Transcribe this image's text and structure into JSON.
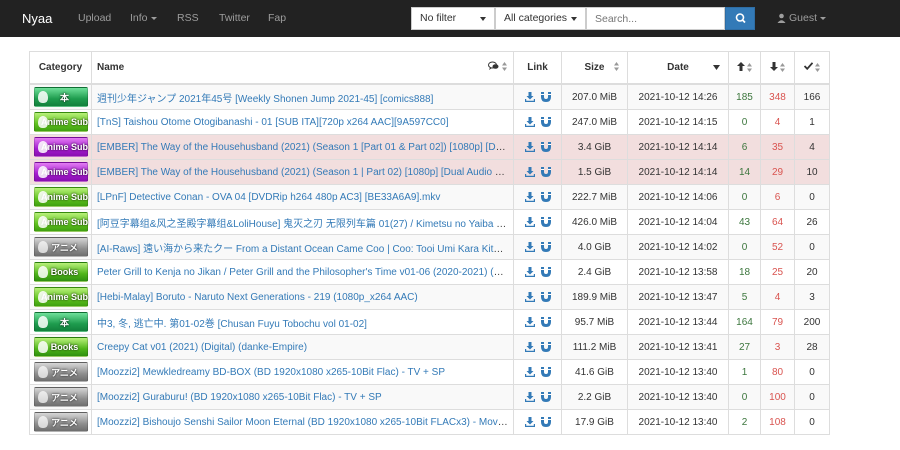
{
  "nav": {
    "brand": "Nyaa",
    "upload": "Upload",
    "info": "Info",
    "rss": "RSS",
    "twitter": "Twitter",
    "fap": "Fap",
    "filter": "No filter",
    "categories": "All categories",
    "search_placeholder": "Search...",
    "guest": "Guest"
  },
  "headers": {
    "category": "Category",
    "name": "Name",
    "link": "Link",
    "size": "Size",
    "date": "Date"
  },
  "colors": {
    "navbar": "#222222",
    "link": "#337ab7",
    "seeders": "#3c763d",
    "leechers": "#d9534f",
    "danger_row": "#f2dede",
    "search_button": "#337ab7"
  },
  "rows": [
    {
      "cat": "本",
      "cat_icon": "literature-raw",
      "name": "週刊少年ジャンプ 2021年45号 [Weekly Shonen Jump 2021-45] [comics888]",
      "size": "207.0 MiB",
      "date": "2021-10-12 14:26",
      "seeders": "185",
      "leechers": "348",
      "completed": "166",
      "row_type": "default"
    },
    {
      "cat": "Anime Sub",
      "cat_icon": "anime-non-english",
      "name": "[TnS] Taishou Otome Otogibanashi - 01 [SUB ITA][720p x264 AAC][9A597CC0]",
      "size": "247.0 MiB",
      "date": "2021-10-12 14:15",
      "seeders": "0",
      "leechers": "4",
      "completed": "1",
      "row_type": "default"
    },
    {
      "cat": "Anime Sub",
      "cat_icon": "anime-english",
      "name": "[EMBER] The Way of the Househusband (2021) (Season 1 [Part 01 & Part 02]) [1080p] [Du...",
      "size": "3.4 GiB",
      "date": "2021-10-12 14:14",
      "seeders": "6",
      "leechers": "35",
      "completed": "4",
      "row_type": "danger"
    },
    {
      "cat": "Anime Sub",
      "cat_icon": "anime-english",
      "name": "[EMBER] The Way of the Househusband (2021) (Season 1 | Part 02) [1080p] [Dual Audio H...",
      "size": "1.5 GiB",
      "date": "2021-10-12 14:14",
      "seeders": "14",
      "leechers": "29",
      "completed": "10",
      "row_type": "danger"
    },
    {
      "cat": "Anime Sub",
      "cat_icon": "anime-non-english",
      "name": "[LPnF] Detective Conan - OVA 04 [DVDRip h264 480p AC3] [BE33A6A9].mkv",
      "size": "222.7 MiB",
      "date": "2021-10-12 14:06",
      "seeders": "0",
      "leechers": "6",
      "completed": "0",
      "row_type": "default"
    },
    {
      "cat": "Anime Sub",
      "cat_icon": "anime-non-english",
      "name": "[阿豆字幕组&风之圣殿字幕组&LoliHouse] 鬼灭之刃 无限列车篇 01(27) / Kimetsu no Yaiba - ...",
      "size": "426.0 MiB",
      "date": "2021-10-12 14:04",
      "seeders": "43",
      "leechers": "64",
      "completed": "26",
      "row_type": "default"
    },
    {
      "cat": "アニメ",
      "cat_icon": "anime-raw",
      "name": "[AI-Raws] 遠い海から来たクー From a Distant Ocean Came Coo | Coo: Tooi Umi Kara Kita ...",
      "size": "4.0 GiB",
      "date": "2021-10-12 14:02",
      "seeders": "0",
      "leechers": "52",
      "completed": "0",
      "row_type": "default"
    },
    {
      "cat": "Books",
      "cat_icon": "literature-english",
      "name": "Peter Grill to Kenja no Jikan / Peter Grill and the Philosopher's Time v01-06 (2020-2021) (Di...",
      "size": "2.4 GiB",
      "date": "2021-10-12 13:58",
      "seeders": "18",
      "leechers": "25",
      "completed": "20",
      "row_type": "default"
    },
    {
      "cat": "Anime Sub",
      "cat_icon": "anime-non-english",
      "name": "[Hebi-Malay] Boruto - Naruto Next Generations - 219 (1080p_x264 AAC)",
      "size": "189.9 MiB",
      "date": "2021-10-12 13:47",
      "seeders": "5",
      "leechers": "4",
      "completed": "3",
      "row_type": "default"
    },
    {
      "cat": "本",
      "cat_icon": "literature-raw",
      "name": "中3, 冬, 逃亡中. 第01-02巻 [Chusan Fuyu Tobochu vol 01-02]",
      "size": "95.7 MiB",
      "date": "2021-10-12 13:44",
      "seeders": "164",
      "leechers": "79",
      "completed": "200",
      "row_type": "default"
    },
    {
      "cat": "Books",
      "cat_icon": "literature-english",
      "name": "Creepy Cat v01 (2021) (Digital) (danke-Empire)",
      "size": "111.2 MiB",
      "date": "2021-10-12 13:41",
      "seeders": "27",
      "leechers": "3",
      "completed": "28",
      "row_type": "default"
    },
    {
      "cat": "アニメ",
      "cat_icon": "anime-raw",
      "name": "[Moozzi2] Mewkledreamy BD-BOX (BD 1920x1080 x265-10Bit Flac) - TV + SP",
      "size": "41.6 GiB",
      "date": "2021-10-12 13:40",
      "seeders": "1",
      "leechers": "80",
      "completed": "0",
      "row_type": "default"
    },
    {
      "cat": "アニメ",
      "cat_icon": "anime-raw",
      "name": "[Moozzi2] Guraburu! (BD 1920x1080 x265-10Bit Flac) - TV + SP",
      "size": "2.2 GiB",
      "date": "2021-10-12 13:40",
      "seeders": "0",
      "leechers": "100",
      "completed": "0",
      "row_type": "default"
    },
    {
      "cat": "アニメ",
      "cat_icon": "anime-raw",
      "name": "[Moozzi2] Bishoujo Senshi Sailor Moon Eternal (BD 1920x1080 x265-10Bit FLACx3) - Movie...",
      "size": "17.9 GiB",
      "date": "2021-10-12 13:40",
      "seeders": "2",
      "leechers": "108",
      "completed": "0",
      "row_type": "default"
    }
  ]
}
